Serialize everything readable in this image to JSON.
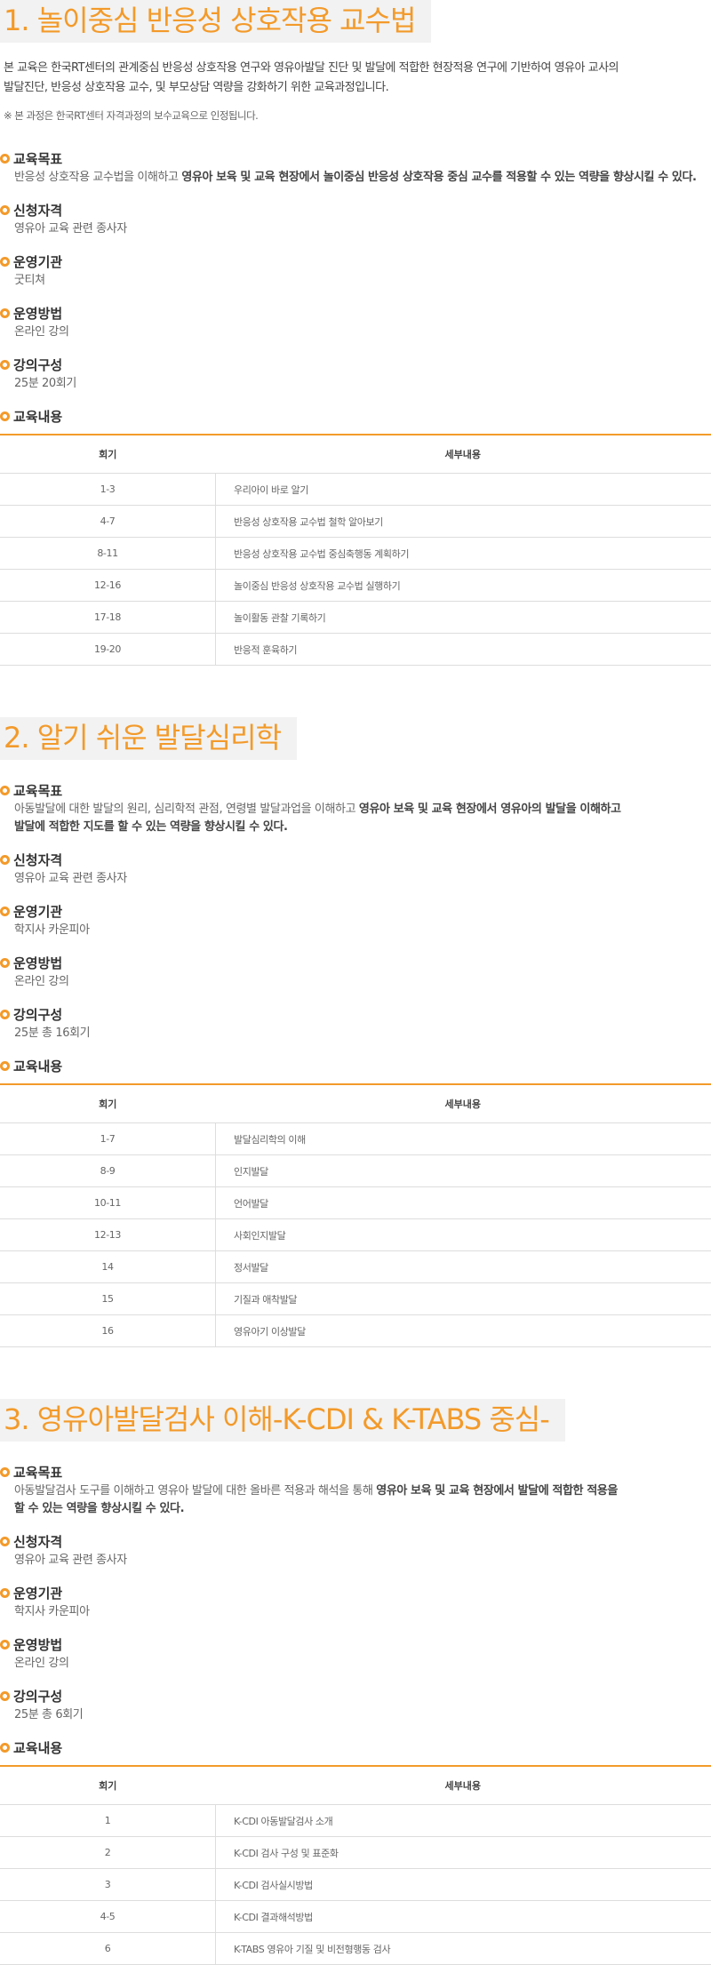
{
  "course1": {
    "title": "1. 놀이중심 반응성 상호작용 교수법",
    "intro_line1": "본 교육은 한국RT센터의 관계중심 반응성 상호작용 연구와 영유아발달 진단 및 발달에  적합한 현장적용 연구에 기반하여 영유아 교사의",
    "intro_line2": "발달진단, 반응성 상호작용 교수, 및 부모상담 역량을 강화하기 위한 교육과정입니다.",
    "note": "※ 본 과정은 한국RT센터 자격과정의 보수교육으로 인정됩니다.",
    "goal_label": "교육목표",
    "goal_text_a": "반응성 상호작용 교수법을 이해하고 ",
    "goal_text_b": "영유아 보육 및 교육 현장에서 놀이중심 반응성 상호작용 중심 교수를 적용할 수 있는 역량을 향상시킬 수 있다.",
    "qual_label": "신청자격",
    "qual_text": "영유아 교육 관련 종사자",
    "org_label": "운영기관",
    "org_text": "굿티쳐",
    "method_label": "운영방법",
    "method_text": "온라인 강의",
    "comp_label": "강의구성",
    "comp_text": "25분 20회기",
    "content_label": "교육내용",
    "col1": "회기",
    "col2": "세부내용",
    "rows": [
      {
        "s": "1-3",
        "d": "우리아이 바로 알기"
      },
      {
        "s": "4-7",
        "d": "반응성 상호작용 교수법 철학 알아보기"
      },
      {
        "s": "8-11",
        "d": "반응성 상호작용 교수법 중심축행동 계획하기"
      },
      {
        "s": "12-16",
        "d": "놀이중심 반응성 상호작용 교수법 실행하기"
      },
      {
        "s": "17-18",
        "d": "놀이활동 관찰 기록하기"
      },
      {
        "s": "19-20",
        "d": "반응적 훈육하기"
      }
    ]
  },
  "course2": {
    "title": "2. 알기 쉬운 발달심리학",
    "goal_label": "교육목표",
    "goal_text_a": "아동발달에 대한 발달의 원리, 심리학적 관점, 연령별 발달과업을 이해하고 ",
    "goal_text_b": "영유아 보육 및 교육 현장에서 영유아의 발달을 이해하고",
    "goal_text_c": "발달에 적합한 지도를 할 수 있는 역량을 향상시킬 수 있다.",
    "qual_label": "신청자격",
    "qual_text": "영유아 교육 관련 종사자",
    "org_label": "운영기관",
    "org_text": "학지사 카운피아",
    "method_label": "운영방법",
    "method_text": "온라인 강의",
    "comp_label": "강의구성",
    "comp_text": "25분 총 16회기",
    "content_label": "교육내용",
    "col1": "회기",
    "col2": "세부내용",
    "rows": [
      {
        "s": "1-7",
        "d": "발달심리학의 이해"
      },
      {
        "s": "8-9",
        "d": "인지발달"
      },
      {
        "s": "10-11",
        "d": "언어발달"
      },
      {
        "s": "12-13",
        "d": "사회인지발달"
      },
      {
        "s": "14",
        "d": "정서발달"
      },
      {
        "s": "15",
        "d": "기질과 애착발달"
      },
      {
        "s": "16",
        "d": "영유아기 이상발달"
      }
    ]
  },
  "course3": {
    "title": "3. 영유아발달검사 이해-K-CDI & K-TABS 중심-",
    "goal_label": "교육목표",
    "goal_text_a": "아동발달검사 도구를 이해하고 영유아 발달에 대한 올바른 적용과 해석을 통해 ",
    "goal_text_b": "영유아 보육 및 교육 현장에서 발달에 적합한 적용을",
    "goal_text_c": "할 수 있는 역량을 향상시킬 수 있다.",
    "qual_label": "신청자격",
    "qual_text": "영유아 교육 관련 종사자",
    "org_label": "운영기관",
    "org_text": "학지사 카운피아",
    "method_label": "운영방법",
    "method_text": "온라인 강의",
    "comp_label": "강의구성",
    "comp_text": "25분 총 6회기",
    "content_label": "교육내용",
    "col1": "회기",
    "col2": "세부내용",
    "rows": [
      {
        "s": "1",
        "d": "K-CDI 아동발달검사 소개"
      },
      {
        "s": "2",
        "d": "K-CDI 검사 구성 및 표준화"
      },
      {
        "s": "3",
        "d": "K-CDI 검사실시방법"
      },
      {
        "s": "4-5",
        "d": "K-CDI 결과해석방법"
      },
      {
        "s": "6",
        "d": "K-TABS 영유아 기질 및 비전형행동 검사"
      }
    ]
  },
  "colors": {
    "accent": "#f39a2a",
    "title_bg": "#f2f2f2",
    "rule": "#dddddd"
  }
}
